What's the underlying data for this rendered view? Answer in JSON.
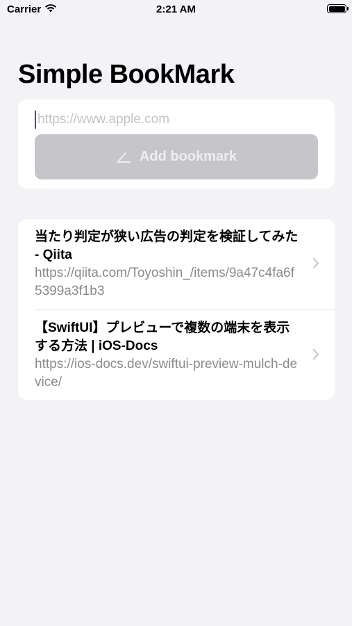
{
  "status_bar": {
    "carrier": "Carrier",
    "time": "2:21 AM"
  },
  "title": "Simple BookMark",
  "input": {
    "value": "",
    "placeholder": "https://www.apple.com"
  },
  "add_button": {
    "label": "Add bookmark",
    "icon": "pencil-icon",
    "disabled": true
  },
  "bookmarks": [
    {
      "title": "当たり判定が狭い広告の判定を検証してみた - Qiita",
      "url": "https://qiita.com/Toyoshin_/items/9a47c4fa6f5399a3f1b3"
    },
    {
      "title": "【SwiftUI】プレビューで複数の端末を表示する方法 | iOS-Docs",
      "url": "https://ios-docs.dev/swiftui-preview-mulch-device/"
    }
  ],
  "colors": {
    "background": "#f2f2f7",
    "card": "#ffffff",
    "button_disabled": "#c6c6ca",
    "caret": "#3b48d8",
    "secondary_text": "#8a8a8e"
  }
}
